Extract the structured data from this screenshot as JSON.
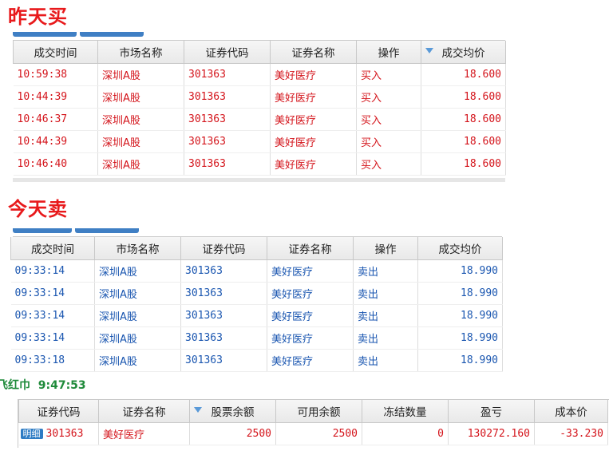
{
  "yesterday_buy": {
    "title": "昨天买",
    "columns": [
      "成交时间",
      "市场名称",
      "证券代码",
      "证券名称",
      "操作",
      "成交均价"
    ],
    "rows": [
      {
        "time": "10:59:38",
        "market": "深圳A股",
        "code": "301363",
        "name": "美好医疗",
        "action": "买入",
        "price": "18.600"
      },
      {
        "time": "10:44:39",
        "market": "深圳A股",
        "code": "301363",
        "name": "美好医疗",
        "action": "买入",
        "price": "18.600"
      },
      {
        "time": "10:46:37",
        "market": "深圳A股",
        "code": "301363",
        "name": "美好医疗",
        "action": "买入",
        "price": "18.600"
      },
      {
        "time": "10:44:39",
        "market": "深圳A股",
        "code": "301363",
        "name": "美好医疗",
        "action": "买入",
        "price": "18.600"
      },
      {
        "time": "10:46:40",
        "market": "深圳A股",
        "code": "301363",
        "name": "美好医疗",
        "action": "买入",
        "price": "18.600"
      }
    ]
  },
  "today_sell": {
    "title": "今天卖",
    "columns": [
      "成交时间",
      "市场名称",
      "证券代码",
      "证券名称",
      "操作",
      "成交均价"
    ],
    "rows": [
      {
        "time": "09:33:14",
        "market": "深圳A股",
        "code": "301363",
        "name": "美好医疗",
        "action": "卖出",
        "price": "18.990"
      },
      {
        "time": "09:33:14",
        "market": "深圳A股",
        "code": "301363",
        "name": "美好医疗",
        "action": "卖出",
        "price": "18.990"
      },
      {
        "time": "09:33:14",
        "market": "深圳A股",
        "code": "301363",
        "name": "美好医疗",
        "action": "卖出",
        "price": "18.990"
      },
      {
        "time": "09:33:14",
        "market": "深圳A股",
        "code": "301363",
        "name": "美好医疗",
        "action": "卖出",
        "price": "18.990"
      },
      {
        "time": "09:33:18",
        "market": "深圳A股",
        "code": "301363",
        "name": "美好医疗",
        "action": "卖出",
        "price": "18.990"
      }
    ]
  },
  "clock": {
    "label": "飞红巾",
    "time": "9:47:53"
  },
  "holdings": {
    "columns": [
      "证券代码",
      "证券名称",
      "股票余额",
      "可用余额",
      "冻结数量",
      "盈亏",
      "成本价"
    ],
    "detail_label": "明细",
    "row": {
      "code": "301363",
      "name": "美好医疗",
      "balance": "2500",
      "available": "2500",
      "frozen": "0",
      "pnl": "130272.160",
      "cost": "-33.230"
    }
  },
  "colors": {
    "heading": "#e8191b",
    "buy_text": "#d4141b",
    "sell_text": "#1a56b0",
    "clock": "#1f8a3a",
    "tab": "#3f7fc4"
  },
  "icons": {
    "sort": "sort-desc-icon"
  }
}
